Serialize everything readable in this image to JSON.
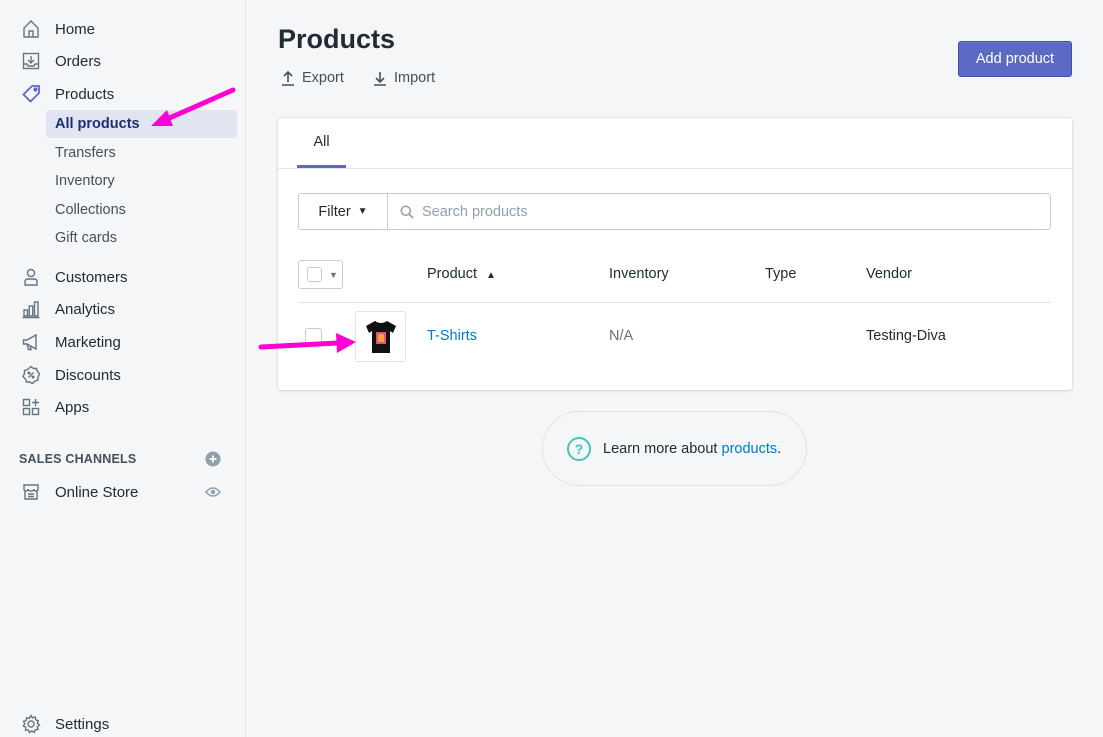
{
  "sidebar": {
    "items": [
      {
        "label": "Home",
        "icon": "home-icon"
      },
      {
        "label": "Orders",
        "icon": "orders-icon"
      },
      {
        "label": "Products",
        "icon": "tag-icon"
      }
    ],
    "products_subitems": [
      {
        "label": "All products",
        "active": true
      },
      {
        "label": "Transfers"
      },
      {
        "label": "Inventory"
      },
      {
        "label": "Collections"
      },
      {
        "label": "Gift cards"
      }
    ],
    "items_more": [
      {
        "label": "Customers",
        "icon": "customers-icon"
      },
      {
        "label": "Analytics",
        "icon": "analytics-icon"
      },
      {
        "label": "Marketing",
        "icon": "marketing-icon"
      },
      {
        "label": "Discounts",
        "icon": "discounts-icon"
      },
      {
        "label": "Apps",
        "icon": "apps-icon"
      }
    ],
    "sales_channels_title": "SALES CHANNELS",
    "online_store_label": "Online Store",
    "settings_label": "Settings"
  },
  "header": {
    "title": "Products",
    "export_label": "Export",
    "import_label": "Import",
    "add_product_label": "Add product"
  },
  "tabs": {
    "all_label": "All"
  },
  "filter": {
    "button_label": "Filter",
    "search_placeholder": "Search products"
  },
  "table": {
    "columns": {
      "product": "Product",
      "inventory": "Inventory",
      "type": "Type",
      "vendor": "Vendor"
    },
    "rows": [
      {
        "product": "T-Shirts",
        "inventory": "N/A",
        "type": "",
        "vendor": "Testing-Diva"
      }
    ]
  },
  "learn_more": {
    "prefix": "Learn more about ",
    "link": "products",
    "suffix": "."
  },
  "colors": {
    "accent": "#5c6ac4",
    "link": "#007ace",
    "annotation_arrow": "#ff00d4",
    "help_icon": "#47c1bf"
  }
}
